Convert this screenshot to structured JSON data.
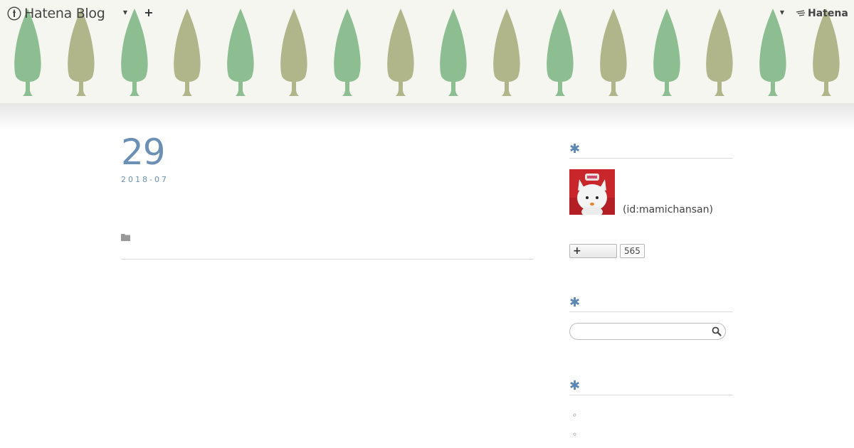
{
  "global_nav": {
    "logo_text": "Hatena Blog",
    "dropdown_icon": "caret-down-icon",
    "write_icon": "plus-icon",
    "hatena_text": "Hatena"
  },
  "banner": {
    "tree_colors": [
      "#8dbe91",
      "#b1b68a"
    ]
  },
  "entry": {
    "day": "29",
    "year_month": "2018-07"
  },
  "sidebar": {
    "profile": {
      "user_id": "(id:mamichansan)"
    },
    "subscribe": {
      "count": "565"
    },
    "search": {
      "value": "",
      "placeholder": ""
    },
    "module_icon": "asterisk",
    "list_items": [
      "◦",
      "◦"
    ]
  },
  "colors": {
    "accent": "#5b86b6",
    "date": "#6b8fb5",
    "banner_bg": "#f6f6f0"
  }
}
